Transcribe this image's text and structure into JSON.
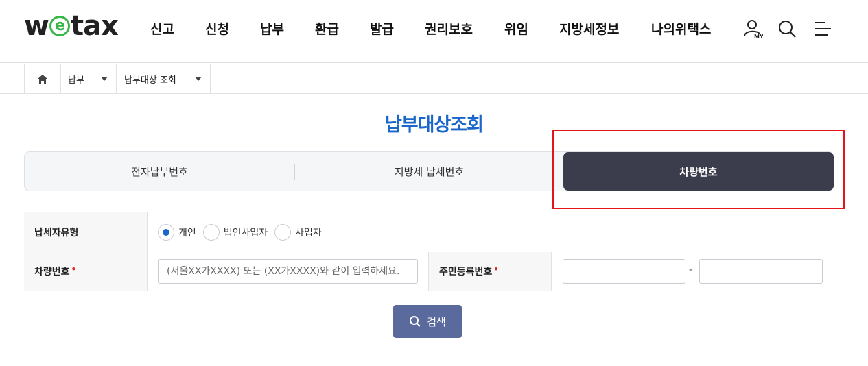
{
  "logo": {
    "prefix": "w",
    "e": "e",
    "suffix": "tax"
  },
  "nav": [
    "신고",
    "신청",
    "납부",
    "환급",
    "발급",
    "권리보호",
    "위임",
    "지방세정보",
    "나의위택스"
  ],
  "header_icons": {
    "my_label": "MY",
    "user": "user-my-icon",
    "search": "search-icon",
    "menu": "menu-icon"
  },
  "breadcrumb": {
    "level1": "납부",
    "level2": "납부대상 조회"
  },
  "page_title": "납부대상조회",
  "tabs": [
    {
      "label": "전자납부번호",
      "active": false
    },
    {
      "label": "지방세 납세번호",
      "active": false
    },
    {
      "label": "차량번호",
      "active": true
    }
  ],
  "form": {
    "taxpayer_type_label": "납세자유형",
    "taxpayer_types": [
      {
        "label": "개인",
        "selected": true
      },
      {
        "label": "법인사업자",
        "selected": false
      },
      {
        "label": "사업자",
        "selected": false
      }
    ],
    "car_number_label": "차량번호",
    "car_number_placeholder": "(서울XX가XXXX) 또는 (XX가XXXX)와 같이 입력하세요.",
    "car_number_value": "",
    "rrn_label": "주민등록번호",
    "rrn_front_value": "",
    "rrn_back_value": "",
    "rrn_separator": "-",
    "required_mark": "•"
  },
  "search_button": "검색",
  "colors": {
    "accent": "#1a66c9",
    "logo_e": "#39b54a",
    "active_tab": "#3b3d4d",
    "search_button": "#5b6a9c",
    "highlight": "#e3151a",
    "required": "#e0281f"
  }
}
